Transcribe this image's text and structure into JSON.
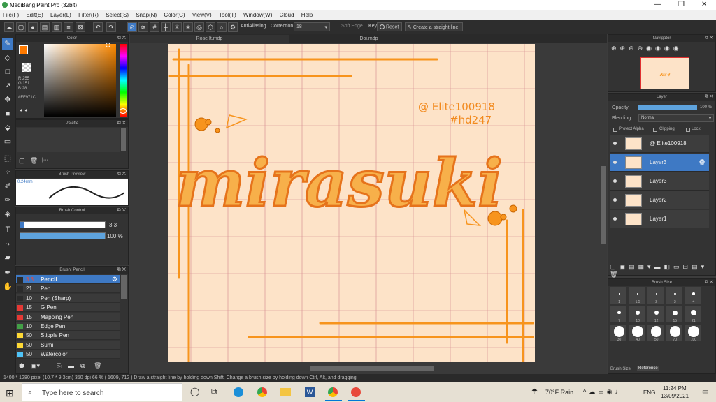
{
  "title": "MediBang Paint Pro (32bit)",
  "menu": [
    "File(F)",
    "Edit(E)",
    "Layer(L)",
    "Filter(R)",
    "Select(S)",
    "Snap(N)",
    "Color(C)",
    "View(V)",
    "Tool(T)",
    "Window(W)",
    "Cloud",
    "Help"
  ],
  "toolbar": {
    "antialias": "AntiAliasing",
    "correction_label": "Correction",
    "correction_value": "18",
    "soft_edge": "Soft Edge",
    "key": "Key",
    "reset": "Reset",
    "straight_line": "Create a straight line"
  },
  "color_panel": {
    "title": "Color",
    "r": "R:255",
    "g": "G:151",
    "b": "B:28",
    "hex": "#FF971C",
    "accent": "#ff971c"
  },
  "palette": {
    "title": "Palette"
  },
  "brush_preview": {
    "title": "Brush Preview",
    "size": "0.24mm"
  },
  "brush_control": {
    "title": "Brush Control",
    "size": "3.3",
    "opacity": "100 %",
    "opacity_fill": 1.0
  },
  "brush_list": {
    "title": "Brush: Pencil",
    "items": [
      {
        "size": "3.3",
        "name": "Pencil",
        "color": "#2b2b2b"
      },
      {
        "size": "21",
        "name": "Pen",
        "color": "#2b2b2b"
      },
      {
        "size": "10",
        "name": "Pen (Sharp)",
        "color": "#2b2b2b"
      },
      {
        "size": "15",
        "name": "G Pen",
        "color": "#e53935"
      },
      {
        "size": "15",
        "name": "Mapping Pen",
        "color": "#e53935"
      },
      {
        "size": "10",
        "name": "Edge Pen",
        "color": "#43a047"
      },
      {
        "size": "50",
        "name": "Stipple Pen",
        "color": "#fdd835"
      },
      {
        "size": "50",
        "name": "Sumi",
        "color": "#fdd835"
      },
      {
        "size": "50",
        "name": "Watercolor",
        "color": "#4fc3f7"
      }
    ]
  },
  "tabs": [
    "Rose It.mdp",
    "Doi.mdp"
  ],
  "canvas": {
    "watermark1": "@ Elite100918",
    "watermark2": "#hd247",
    "title_art": "mirasuki"
  },
  "navigator": {
    "title": "Navigator"
  },
  "layer_panel": {
    "title": "Layer",
    "opacity_label": "Opacity",
    "opacity_value": "100 %",
    "opacity_fill": 1.0,
    "blending_label": "Blending",
    "blending_value": "Normal",
    "protect_alpha": "Protect Alpha",
    "clipping": "Clipping",
    "lock": "Lock",
    "layers": [
      "@ Elite100918",
      "Layer3",
      "Layer3",
      "Layer2",
      "Layer1"
    ]
  },
  "brush_size": {
    "title": "Brush Size",
    "labels": [
      "1",
      "1.5",
      "2",
      "3",
      "4",
      "7",
      "10",
      "12",
      "15",
      "21",
      "30",
      "40",
      "50",
      "70",
      "100"
    ],
    "tabs": [
      "Brush Size",
      "Reference"
    ]
  },
  "status": "1400 * 1280 pixel  (10.7 * 9.3cm)  350 dpi  66 %  ( 1609, 712 )  Draw a straight line by holding down Shift, Change a brush size by holding down Ctrl, Alt, and dragging",
  "taskbar": {
    "search": "Type here to search",
    "weather": "70°F Rain",
    "lang": "ENG",
    "time": "11:24 PM",
    "date": "13/09/2021"
  }
}
